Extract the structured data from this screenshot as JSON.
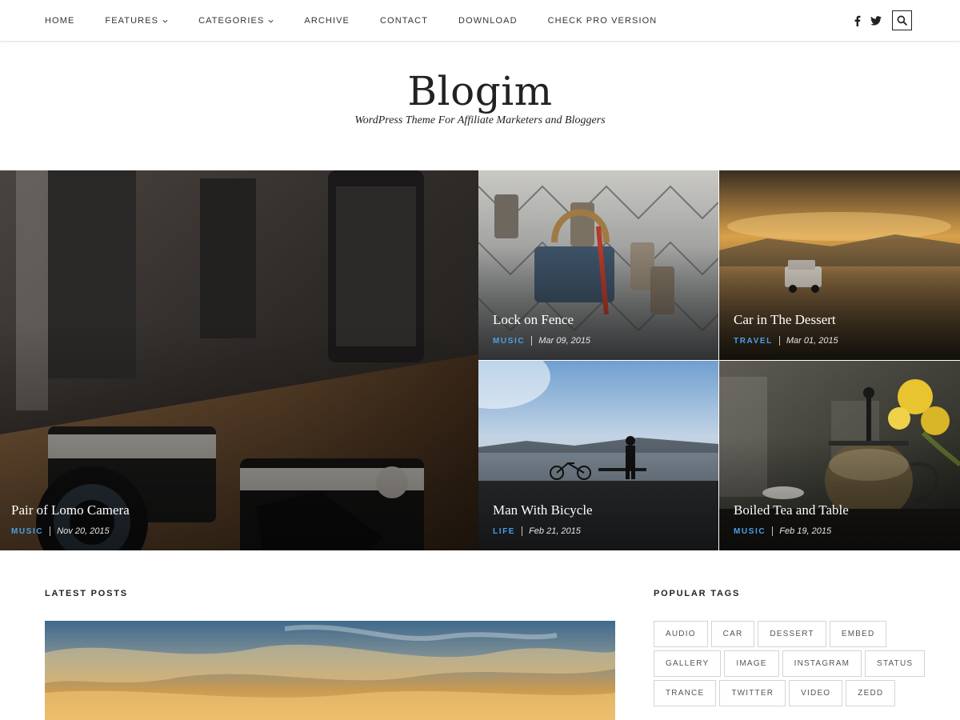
{
  "nav": {
    "items": [
      {
        "label": "Home",
        "has_dropdown": false
      },
      {
        "label": "Features",
        "has_dropdown": true
      },
      {
        "label": "Categories",
        "has_dropdown": true
      },
      {
        "label": "Archive",
        "has_dropdown": false
      },
      {
        "label": "Contact",
        "has_dropdown": false
      },
      {
        "label": "Download",
        "has_dropdown": false
      },
      {
        "label": "Check Pro Version",
        "has_dropdown": false
      }
    ],
    "social_icons": [
      "facebook-icon",
      "twitter-icon"
    ],
    "search_icon": "search-icon"
  },
  "site": {
    "title": "Blogim",
    "tagline": "WordPress Theme For Affiliate Marketers and Bloggers"
  },
  "featured": [
    {
      "title": "Pair of Lomo Camera",
      "category": "Music",
      "date": "Nov 20, 2015"
    },
    {
      "title": "Lock on Fence",
      "category": "Music",
      "date": "Mar 09, 2015"
    },
    {
      "title": "Car in The Dessert",
      "category": "Travel",
      "date": "Mar 01, 2015"
    },
    {
      "title": "Man With Bicycle",
      "category": "Life",
      "date": "Feb 21, 2015"
    },
    {
      "title": "Boiled Tea and Table",
      "category": "Music",
      "date": "Feb 19, 2015"
    }
  ],
  "latest": {
    "heading": "Latest Posts"
  },
  "sidebar": {
    "tags_heading": "Popular Tags",
    "tags": [
      "Audio",
      "Car",
      "Dessert",
      "Embed",
      "Gallery",
      "Image",
      "Instagram",
      "Status",
      "Trance",
      "Twitter",
      "Video",
      "Zedd"
    ]
  },
  "colors": {
    "accent": "#4a9fe8",
    "text": "#222222",
    "tag_border": "#d4d4d4"
  }
}
